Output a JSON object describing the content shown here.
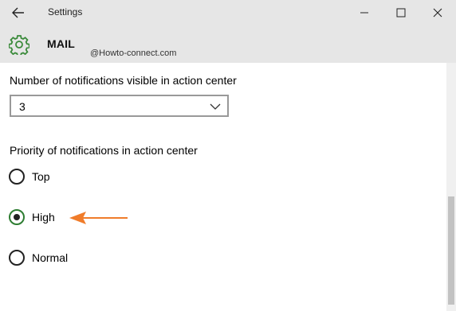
{
  "window": {
    "title": "Settings"
  },
  "header": {
    "title": "MAIL",
    "watermark": "@Howto-connect.com"
  },
  "notifications_count": {
    "label": "Number of notifications visible in action center",
    "selected_value": "3"
  },
  "priority": {
    "label": "Priority of notifications in action center",
    "options": [
      {
        "label": "Top",
        "checked": false
      },
      {
        "label": "High",
        "checked": true
      },
      {
        "label": "Normal",
        "checked": false
      }
    ]
  },
  "colors": {
    "titlebar_bg": "#e6e6e6",
    "accent_check_ring": "#2e7d32",
    "annotation_arrow": "#f07c2a",
    "gear_icon": "#3a8a3a"
  },
  "icons": {
    "back": "back-arrow-icon",
    "minimize": "minimize-icon",
    "maximize": "maximize-icon",
    "close": "close-icon",
    "app": "gear-icon",
    "dropdown": "chevron-down-icon",
    "annotation": "annotation-arrow-icon"
  }
}
